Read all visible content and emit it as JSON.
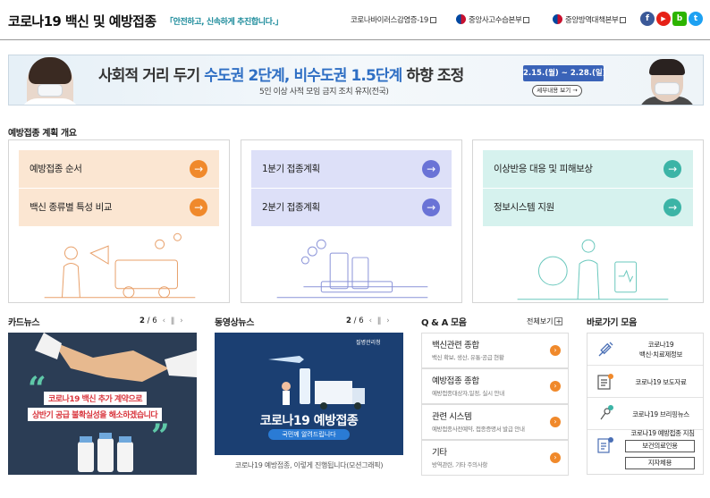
{
  "header": {
    "title": "코로나19 백신 및 예방접종",
    "slogan": "「안전하고, 신속하게 추진합니다.」",
    "links": [
      {
        "label": "코로나바이러스감염증-19"
      },
      {
        "label": "중앙사고수습본부"
      },
      {
        "label": "중앙방역대책본부"
      }
    ],
    "sns": [
      {
        "name": "facebook-icon",
        "glyph": "f",
        "color": "#3b5998"
      },
      {
        "name": "youtube-icon",
        "glyph": "▶",
        "color": "#e62117"
      },
      {
        "name": "blog-icon",
        "glyph": "b",
        "color": "#2db400"
      },
      {
        "name": "twitter-icon",
        "glyph": "t",
        "color": "#1da1f2"
      }
    ]
  },
  "banner": {
    "headline_a": "사회적 거리 두기 ",
    "headline_b": "수도권 2단계, 비수도권 1.5단계",
    "headline_c": " 하향 조정",
    "date": "2.15.(월) ~ 2.28.(일)",
    "sub": "5인 이상 사적 모임 금지 조치 유지(전국)",
    "more": "세부내용 보기 →"
  },
  "section": {
    "title": "예방접종 계획 개요",
    "panels": [
      {
        "buttons": [
          {
            "label": "예방접종 순서"
          },
          {
            "label": "백신 종류별 특성 비교"
          }
        ]
      },
      {
        "buttons": [
          {
            "label": "1분기 접종계획"
          },
          {
            "label": "2분기 접종계획"
          }
        ]
      },
      {
        "buttons": [
          {
            "label": "이상반응 대응 및 피해보상"
          },
          {
            "label": "정보시스템 지원"
          }
        ]
      }
    ]
  },
  "cardnews": {
    "title": "카드뉴스",
    "page": "2",
    "total": "/ 6",
    "text1": "코로나19 백신 추가 계약으로",
    "text2": "상반기 공급 불확실성을 해소하겠습니다"
  },
  "video": {
    "title": "동영상뉴스",
    "page": "2",
    "total": "/ 6",
    "agency": "질병관리청",
    "headline": "코로나19 예방접종",
    "sub": "국민께 알려드립니다",
    "caption": "코로나19 예방접종, 이렇게 진행됩니다(모션그래픽)"
  },
  "qa": {
    "title": "Q & A 모음",
    "all": "전체보기",
    "items": [
      {
        "title": "백신관련 종합",
        "sub": "백신 확보, 생산, 유통·공급 현황"
      },
      {
        "title": "예방접종 종합",
        "sub": "예방접종대상자,일정, 실시 안내"
      },
      {
        "title": "관련 시스템",
        "sub": "예방접종사전예약, 접종증명서 발급 안내"
      },
      {
        "title": "기타",
        "sub": "방역관련, 기타 주의사항"
      }
    ]
  },
  "quick": {
    "title": "바로가기 모음",
    "items": [
      {
        "line1": "코로나19",
        "line2": "백신·치료제정보"
      },
      {
        "line1": "코로나19 보도자료",
        "line2": ""
      },
      {
        "line1": "코로나19 브리핑뉴스",
        "line2": ""
      }
    ],
    "guide": "코로나19 예방접종 지침",
    "btn1": "보건의료인용",
    "btn2": "지자체용"
  }
}
